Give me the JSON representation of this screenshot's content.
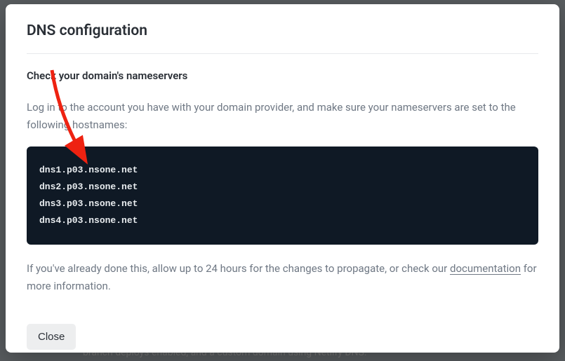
{
  "backdrop_snippet": "branch deploys enabled, and a custom domain using Netlify DNS.",
  "modal": {
    "title": "DNS configuration",
    "heading": "Check your domain's nameservers",
    "intro": "Log in to the account you have with your domain provider, and make sure your nameservers are set to the following hostnames:",
    "nameservers": [
      "dns1.p03.nsone.net",
      "dns2.p03.nsone.net",
      "dns3.p03.nsone.net",
      "dns4.p03.nsone.net"
    ],
    "followup_pre": "If you've already done this, allow up to 24 hours for the changes to propagate, or check our ",
    "doc_link_text": "documentation",
    "followup_post": " for more information.",
    "close_label": "Close"
  }
}
